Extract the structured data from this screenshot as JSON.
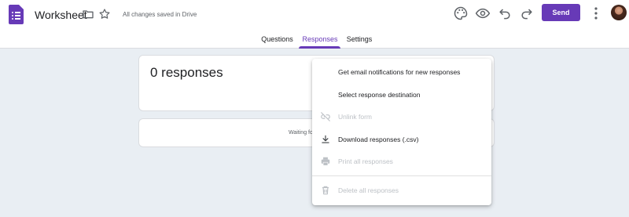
{
  "app": {
    "title": "Worksheet",
    "saved_status": "All changes saved in Drive",
    "send_label": "Send",
    "icons": [
      "forms-logo-icon",
      "folder-icon",
      "star-icon",
      "palette-icon",
      "eye-preview-icon",
      "undo-icon",
      "redo-icon",
      "more-vert-icon"
    ],
    "colors": {
      "accent": "#673ab7",
      "background": "#e9eef3"
    }
  },
  "tabs": [
    {
      "label": "Questions",
      "active": false
    },
    {
      "label": "Responses",
      "active": true
    },
    {
      "label": "Settings",
      "active": false
    }
  ],
  "summary": {
    "count_label": "0 responses"
  },
  "waiting": {
    "text": "Waiting fo"
  },
  "menu": {
    "items": [
      {
        "label": "Get email notifications for new responses",
        "icon": "",
        "enabled": true
      },
      {
        "label": "Select response destination",
        "icon": "",
        "enabled": true
      },
      {
        "label": "Unlink form",
        "icon": "link-off-icon",
        "enabled": false
      },
      {
        "label": "Download responses (.csv)",
        "icon": "download-icon",
        "enabled": true
      },
      {
        "label": "Print all responses",
        "icon": "print-icon",
        "enabled": false
      },
      {
        "label": "Delete all responses",
        "icon": "trash-icon",
        "enabled": false
      }
    ]
  }
}
